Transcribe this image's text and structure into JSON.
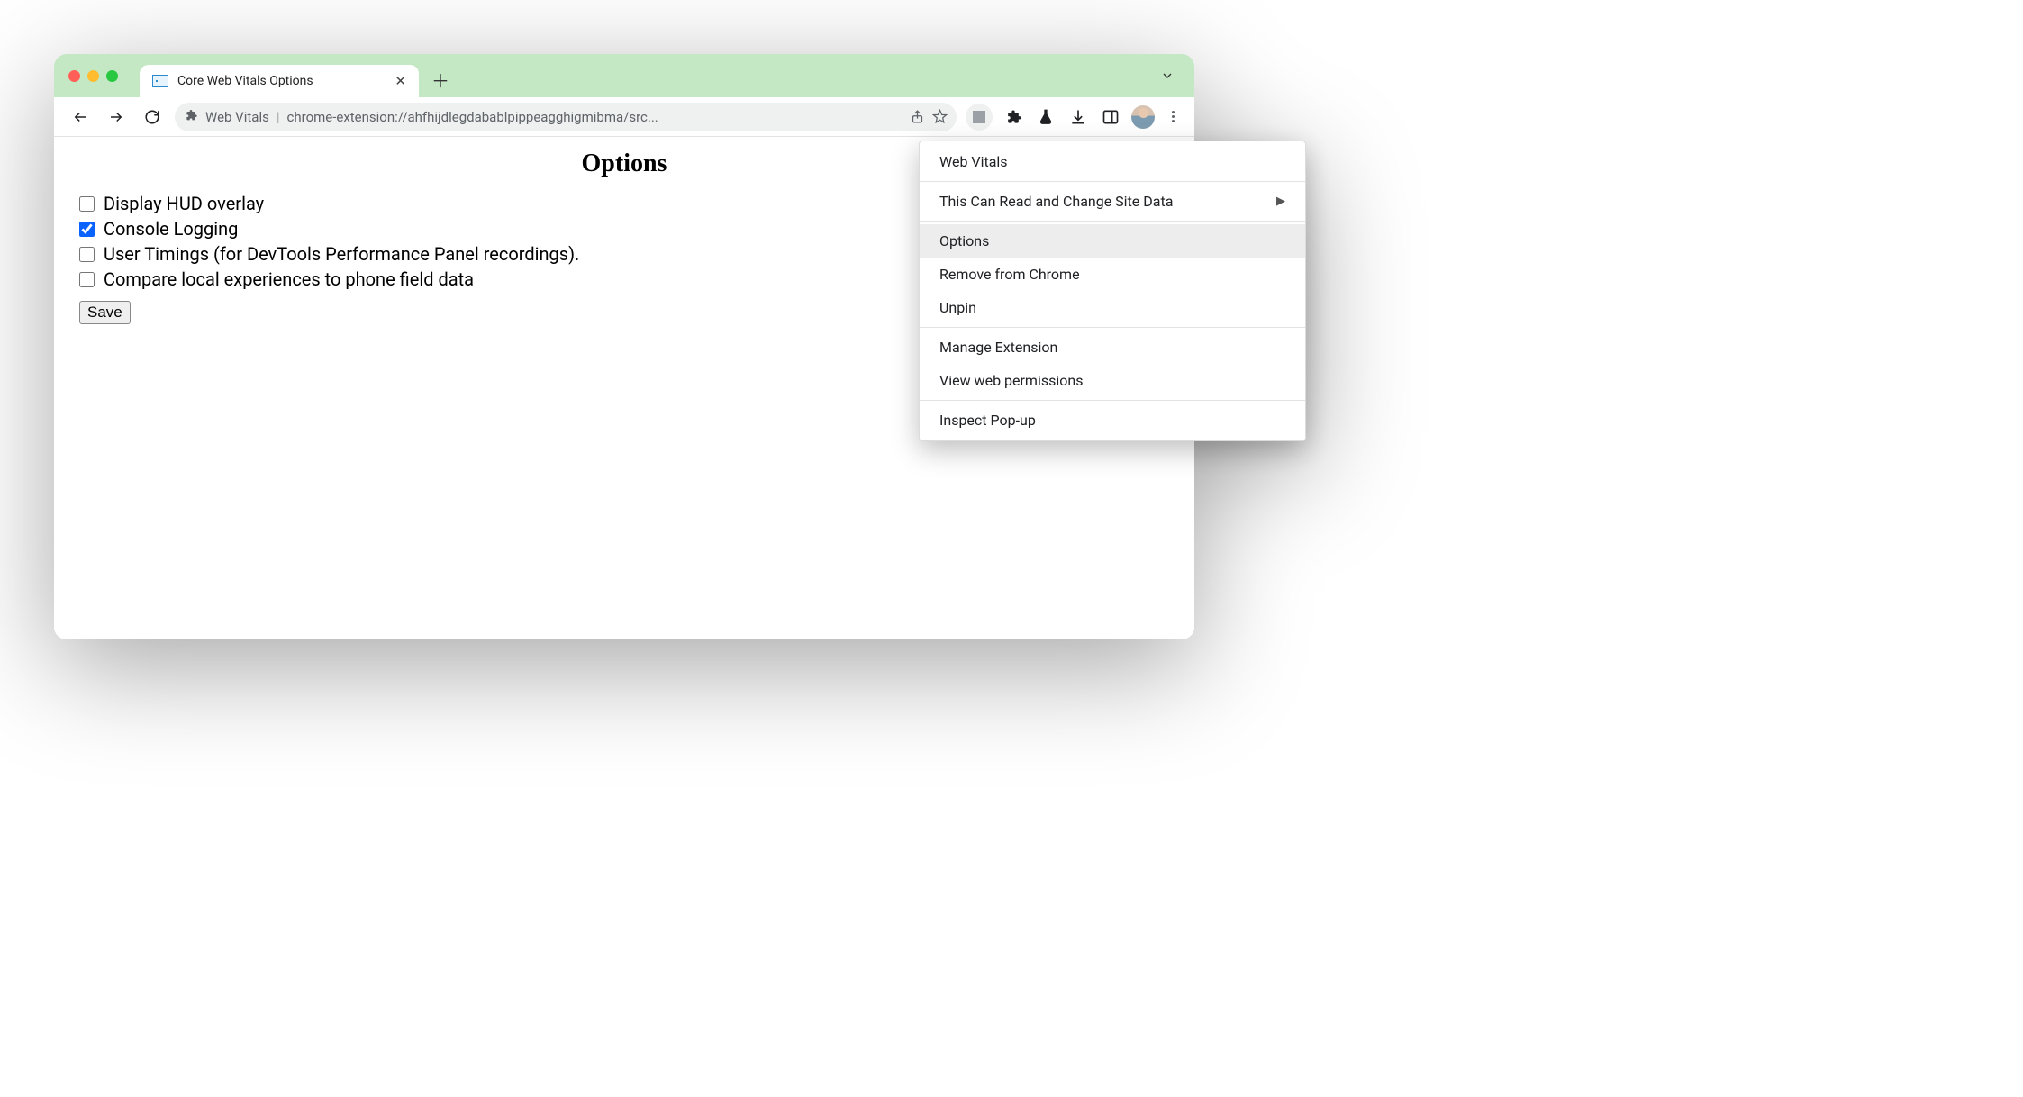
{
  "tab": {
    "title": "Core Web Vitals Options"
  },
  "address": {
    "ext_name": "Web Vitals",
    "url": "chrome-extension://ahfhijdlegdabablpippeagghigmibma/src..."
  },
  "page": {
    "heading": "Options",
    "options": [
      {
        "label": "Display HUD overlay",
        "checked": false
      },
      {
        "label": "Console Logging",
        "checked": true
      },
      {
        "label": "User Timings (for DevTools Performance Panel recordings).",
        "checked": false
      },
      {
        "label": "Compare local experiences to phone field data",
        "checked": false
      }
    ],
    "save_label": "Save"
  },
  "context_menu": {
    "header": "Web Vitals",
    "site_data": "This Can Read and Change Site Data",
    "options": "Options",
    "remove": "Remove from Chrome",
    "unpin": "Unpin",
    "manage": "Manage Extension",
    "view_perms": "View web permissions",
    "inspect": "Inspect Pop-up"
  }
}
